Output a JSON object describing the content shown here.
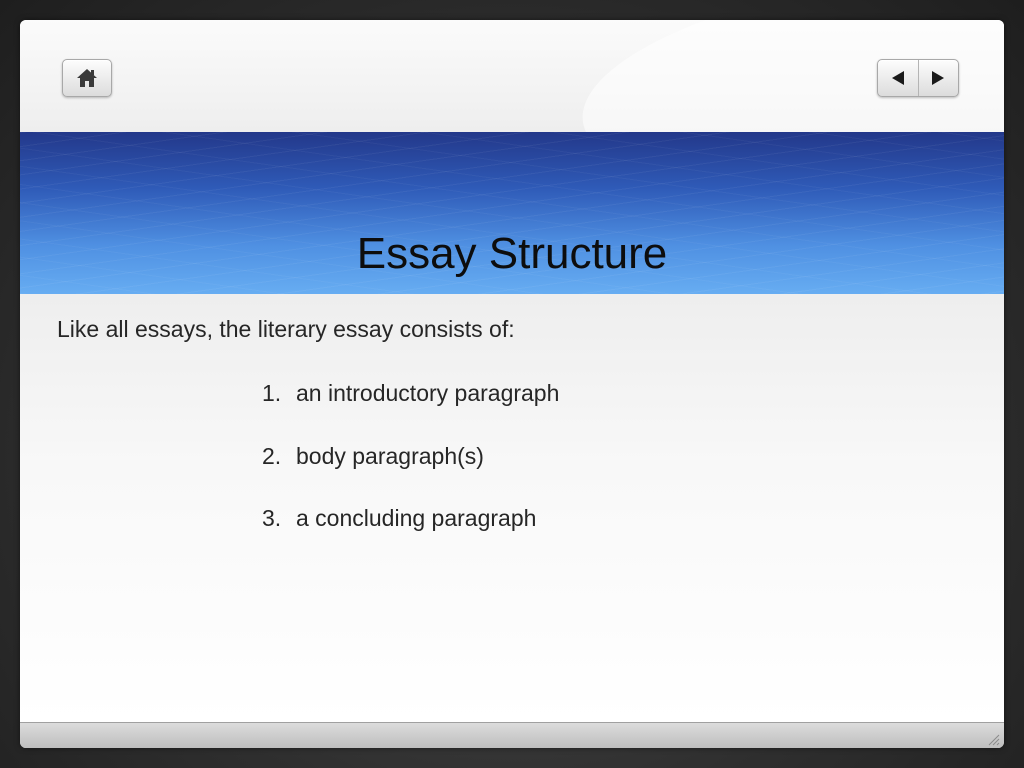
{
  "toolbar": {
    "home_icon": "home-icon",
    "prev_icon": "triangle-left-icon",
    "next_icon": "triangle-right-icon"
  },
  "slide": {
    "title": "Essay Structure",
    "intro": "Like all essays, the literary essay consists of:",
    "items": [
      {
        "number": "1.",
        "text": "an introductory paragraph"
      },
      {
        "number": "2.",
        "text": "body paragraph(s)"
      },
      {
        "number": "3.",
        "text": "a concluding paragraph"
      }
    ]
  },
  "colors": {
    "title_band_top": "#23388a",
    "title_band_bottom": "#67adf2",
    "text": "#262626",
    "frame": "#2f2f2f"
  }
}
